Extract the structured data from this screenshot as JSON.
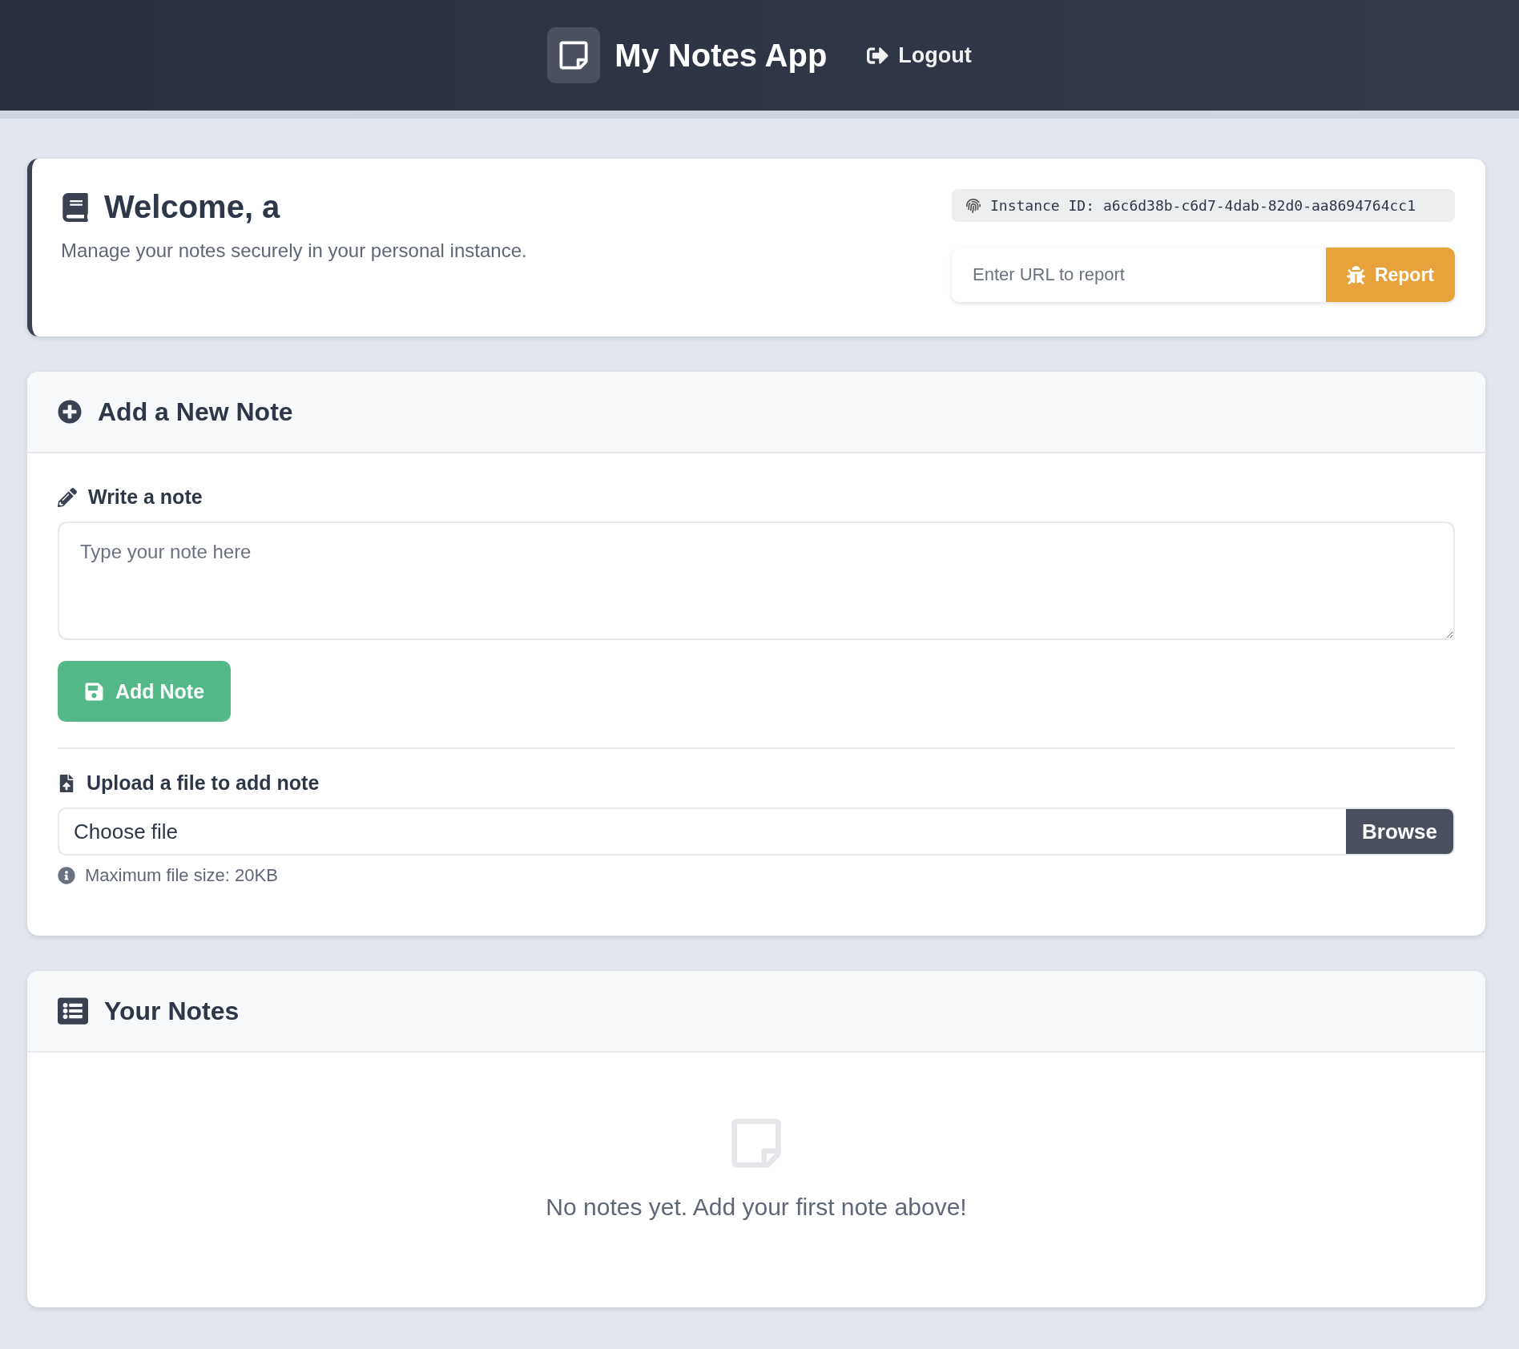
{
  "header": {
    "app_title": "My Notes App",
    "logout": "Logout"
  },
  "welcome": {
    "title": "Welcome, a",
    "subtitle": "Manage your notes securely in your personal instance.",
    "instance_id": "Instance ID: a6c6d38b-c6d7-4dab-82d0-aa8694764cc1",
    "report_field": {
      "placeholder": "Enter URL to report"
    },
    "report_button": "Report"
  },
  "add_note": {
    "title": "Add a New Note",
    "write_label": "Write a note",
    "note_field": {
      "placeholder": "Type your note here"
    },
    "add_button": "Add Note",
    "upload_label": "Upload a file to add note",
    "file_field": {
      "value": "Choose file",
      "button": "Browse"
    },
    "hint": "Maximum file size: 20KB"
  },
  "notes": {
    "title": "Your Notes",
    "empty_message": "No notes yet. Add your first note above!"
  }
}
